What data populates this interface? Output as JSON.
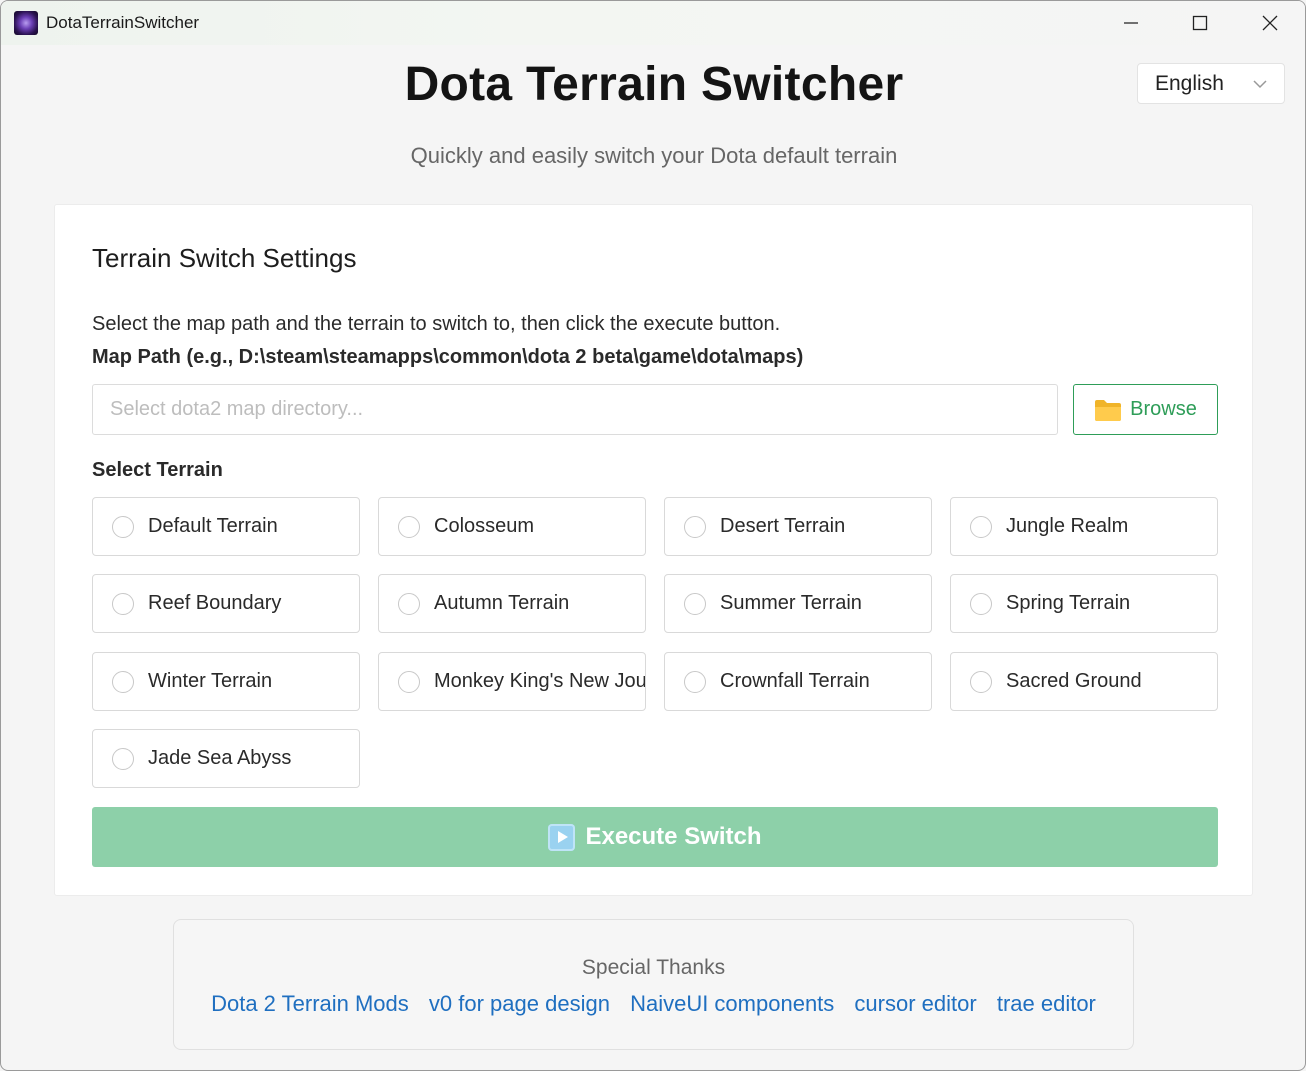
{
  "window": {
    "title": "DotaTerrainSwitcher"
  },
  "language": {
    "selected": "English"
  },
  "header": {
    "title": "Dota Terrain Switcher",
    "subtitle": "Quickly and easily switch your Dota default terrain"
  },
  "settings": {
    "title": "Terrain Switch Settings",
    "instructions": "Select the map path and the terrain to switch to, then click the execute button.",
    "path_label": "Map Path (e.g., D:\\steam\\steamapps\\common\\dota 2 beta\\game\\dota\\maps)",
    "path_value": "",
    "path_placeholder": "Select dota2 map directory...",
    "browse_label": "Browse",
    "terrain_label": "Select Terrain",
    "terrains": [
      {
        "label": "Default Terrain"
      },
      {
        "label": "Colosseum"
      },
      {
        "label": "Desert Terrain"
      },
      {
        "label": "Jungle Realm"
      },
      {
        "label": "Reef Boundary"
      },
      {
        "label": "Autumn Terrain"
      },
      {
        "label": "Summer Terrain"
      },
      {
        "label": "Spring Terrain"
      },
      {
        "label": "Winter Terrain"
      },
      {
        "label": "Monkey King's New Journey"
      },
      {
        "label": "Crownfall Terrain"
      },
      {
        "label": "Sacred Ground"
      },
      {
        "label": "Jade Sea Abyss"
      }
    ],
    "execute_label": "Execute Switch"
  },
  "thanks": {
    "title": "Special Thanks",
    "links": [
      {
        "label": "Dota 2 Terrain Mods"
      },
      {
        "label": "v0 for page design"
      },
      {
        "label": "NaiveUI components"
      },
      {
        "label": "cursor editor"
      },
      {
        "label": "trae editor"
      }
    ]
  },
  "colors": {
    "accent_green": "#2e9d58",
    "execute_disabled": "#8dd0a9",
    "link_blue": "#1f6fc0"
  }
}
